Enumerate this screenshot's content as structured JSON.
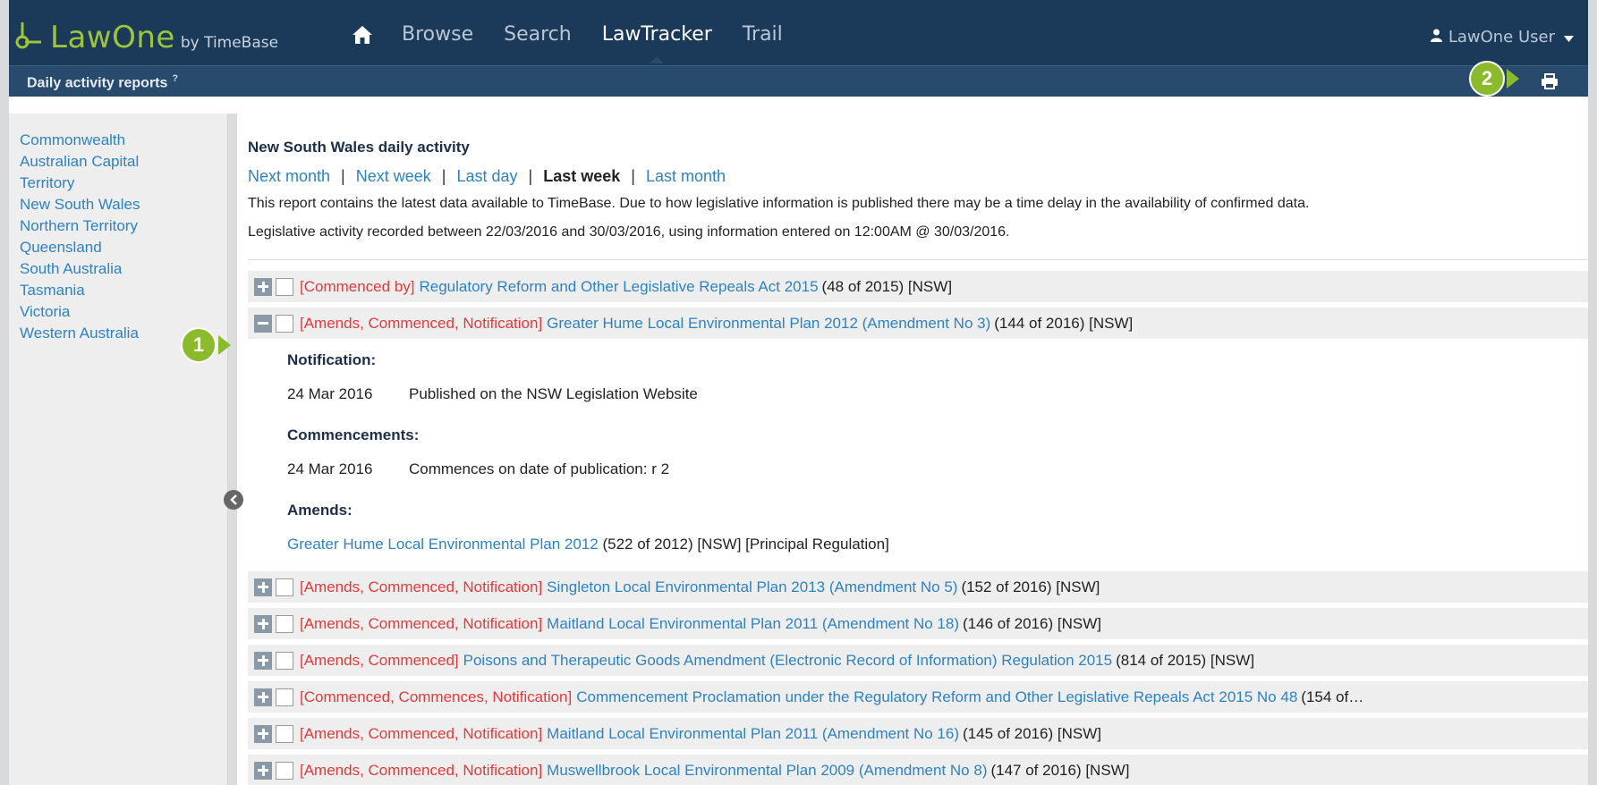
{
  "app": {
    "logo_name": "LawOne",
    "logo_by": "by TimeBase",
    "nav": [
      "Browse",
      "Search",
      "LawTracker",
      "Trail"
    ],
    "active_nav": "LawTracker",
    "user_label": "LawOne User",
    "subheader_title": "Daily activity reports",
    "subheader_help": "?"
  },
  "callouts": {
    "one": "1",
    "two": "2"
  },
  "sidebar": {
    "items": [
      "Commonwealth",
      "Australian Capital Territory",
      "New South Wales",
      "Northern Territory",
      "Queensland",
      "South Australia",
      "Tasmania",
      "Victoria",
      "Western Australia"
    ]
  },
  "report": {
    "title": "New South Wales daily activity",
    "periods": [
      {
        "label": "Next month",
        "current": false
      },
      {
        "label": "Next week",
        "current": false
      },
      {
        "label": "Last day",
        "current": false
      },
      {
        "label": "Last week",
        "current": true
      },
      {
        "label": "Last month",
        "current": false
      }
    ],
    "period_separator": "|",
    "note": "This report contains the latest data available to TimeBase. Due to how legislative information is published there may be a time delay in the availability of confirmed data.",
    "range": "Legislative activity recorded between 22/03/2016 and 30/03/2016, using information entered on 12:00AM @ 30/03/2016."
  },
  "rows": [
    {
      "tags": "[Commenced by]",
      "title": "Regulatory Reform and Other Legislative Repeals Act 2015",
      "meta": "(48 of 2015) [NSW]"
    },
    {
      "tags": "[Amends, Commenced, Notification]",
      "title": "Greater Hume Local Environmental Plan 2012 (Amendment No 3)",
      "meta": "(144 of 2016) [NSW]"
    },
    {
      "tags": "[Amends, Commenced, Notification]",
      "title": "Singleton Local Environmental Plan 2013 (Amendment No 5)",
      "meta": "(152 of 2016) [NSW]"
    },
    {
      "tags": "[Amends, Commenced, Notification]",
      "title": "Maitland Local Environmental Plan 2011 (Amendment No 18)",
      "meta": "(146 of 2016) [NSW]"
    },
    {
      "tags": "[Amends, Commenced]",
      "title": "Poisons and Therapeutic Goods Amendment (Electronic Record of Information) Regulation 2015",
      "meta": "(814 of 2015) [NSW]"
    },
    {
      "tags": "[Commenced, Commences, Notification]",
      "title": "Commencement Proclamation under the Regulatory Reform and Other Legislative Repeals Act 2015 No 48",
      "meta": "(154 of…"
    },
    {
      "tags": "[Amends, Commenced, Notification]",
      "title": "Maitland Local Environmental Plan 2011 (Amendment No 16)",
      "meta": "(145 of 2016) [NSW]"
    },
    {
      "tags": "[Amends, Commenced, Notification]",
      "title": "Muswellbrook Local Environmental Plan 2009 (Amendment No 8)",
      "meta": "(147 of 2016) [NSW]"
    }
  ],
  "detail": {
    "notification_heading": "Notification:",
    "notification_date": "24 Mar 2016",
    "notification_text": "Published on the NSW Legislation Website",
    "commencements_heading": "Commencements:",
    "commencement_date": "24 Mar 2016",
    "commencement_text": "Commences on date of publication: r 2",
    "amends_heading": "Amends:",
    "amends_link": "Greater Hume Local Environmental Plan 2012",
    "amends_meta": "(522 of 2012) [NSW] [Principal Regulation]"
  },
  "colors": {
    "header": "#1b3a5a",
    "subheader": "#284a6c",
    "accent_green": "#8bbb2c",
    "link_blue": "#2f82c1",
    "tag_red": "#e23a3a"
  }
}
